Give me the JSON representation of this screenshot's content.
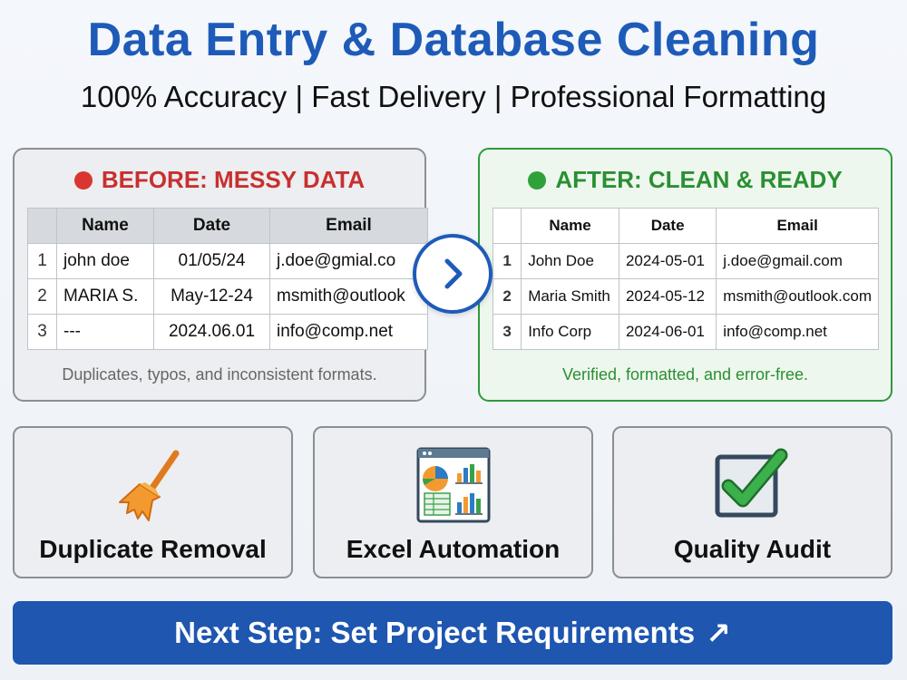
{
  "header": {
    "title": "Data Entry & Database Cleaning",
    "subtitle": "100% Accuracy | Fast Delivery | Professional Formatting"
  },
  "before": {
    "heading": "BEFORE: MESSY DATA",
    "columns": [
      "",
      "Name",
      "Date",
      "Email"
    ],
    "rows": [
      {
        "num": "1",
        "name": "john doe",
        "date": "01/05/24",
        "email": "j.doe@gmial.co"
      },
      {
        "num": "2",
        "name": "MARIA S.",
        "date": "May-12-24",
        "email": "msmith@outlook"
      },
      {
        "num": "3",
        "name": "---",
        "date": "2024.06.01",
        "email": "info@comp.net"
      }
    ],
    "footnote": "Duplicates, typos, and inconsistent formats."
  },
  "after": {
    "heading": "AFTER: CLEAN & READY",
    "columns": [
      "",
      "Name",
      "Date",
      "Email"
    ],
    "rows": [
      {
        "num": "1",
        "name": "John Doe",
        "date": "2024-05-01",
        "email": "j.doe@gmail.com"
      },
      {
        "num": "2",
        "name": "Maria Smith",
        "date": "2024-05-12",
        "email": "msmith@outlook.com"
      },
      {
        "num": "3",
        "name": "Info Corp",
        "date": "2024-06-01",
        "email": "info@comp.net"
      }
    ],
    "footnote": "Verified, formatted, and error-free."
  },
  "transform_button": {
    "icon": "chevron-right-icon"
  },
  "features": [
    {
      "label": "Duplicate Removal",
      "icon": "broom-icon"
    },
    {
      "label": "Excel Automation",
      "icon": "spreadsheet-chart-icon"
    },
    {
      "label": "Quality Audit",
      "icon": "checkbox-checked-icon"
    }
  ],
  "cta": {
    "label": "Next Step: Set Project Requirements",
    "arrow": "↗"
  },
  "colors": {
    "title_blue": "#1e5bb8",
    "before_red": "#c8302e",
    "after_green": "#2a8f33",
    "cta_blue": "#1e56b0"
  }
}
